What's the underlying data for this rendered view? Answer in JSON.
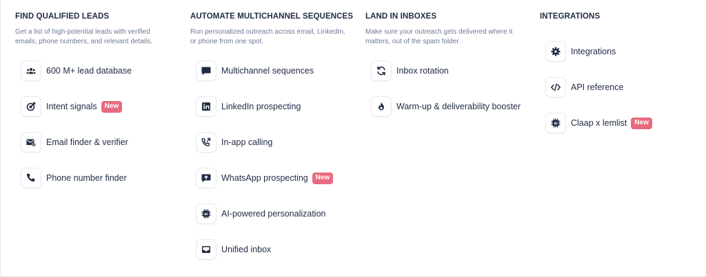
{
  "columns": [
    {
      "title": "FIND QUALIFIED LEADS",
      "desc1": "Get a list of high-potential leads with verified",
      "desc2": "emails, phone numbers, and relevant details.",
      "items": [
        {
          "label": "600 M+ lead database",
          "icon": "users-icon"
        },
        {
          "label": "Intent signals",
          "icon": "target-icon",
          "badge": "New"
        },
        {
          "label": "Email finder & verifier",
          "icon": "email-check-icon"
        },
        {
          "label": "Phone number finder",
          "icon": "phone-icon"
        }
      ]
    },
    {
      "title": "AUTOMATE MULTICHANNEL SEQUENCES",
      "desc1": "Run personalized outreach across email, LinkedIn,",
      "desc2": "or phone from one spot.",
      "items": [
        {
          "label": "Multichannel sequences",
          "icon": "chat-bubble-icon"
        },
        {
          "label": "LinkedIn prospecting",
          "icon": "linkedin-icon"
        },
        {
          "label": "In-app calling",
          "icon": "phone-call-icon"
        },
        {
          "label": "WhatsApp prospecting",
          "icon": "message-arrow-icon",
          "badge": "New"
        },
        {
          "label": "AI-powered personalization",
          "icon": "ai-chip-icon"
        },
        {
          "label": "Unified inbox",
          "icon": "inbox-icon"
        }
      ]
    },
    {
      "title": "LAND IN INBOXES",
      "desc1": "Make sure your outreach gets delivered where it",
      "desc2": "matters, out of the spam folder.",
      "items": [
        {
          "label": "Inbox rotation",
          "icon": "rotate-icon"
        },
        {
          "label": "Warm-up & deliverability booster",
          "icon": "flame-icon"
        }
      ]
    },
    {
      "title": "INTEGRATIONS",
      "items": [
        {
          "label": "Integrations",
          "icon": "gear-icon"
        },
        {
          "label": "API reference",
          "icon": "code-icon"
        },
        {
          "label": "Claap x lemlist",
          "icon": "ai-chip-icon",
          "badge": "New"
        }
      ]
    }
  ],
  "colors": {
    "text": "#1f2a44",
    "muted": "#6c7a93",
    "badge": "#e86a7e",
    "border": "#e6e9ef"
  }
}
